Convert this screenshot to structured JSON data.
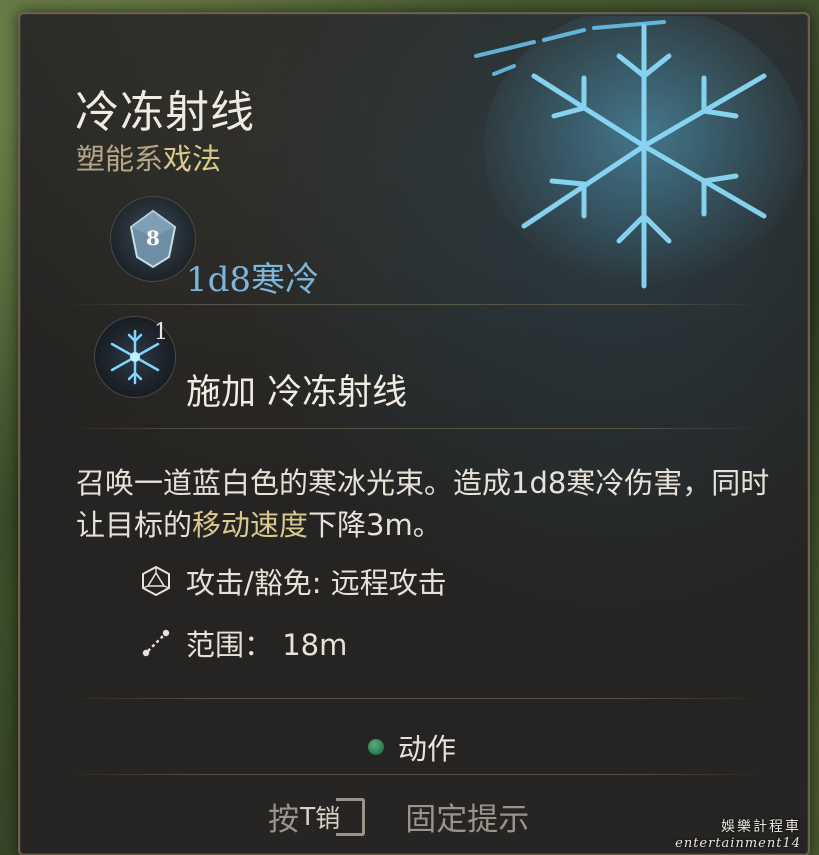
{
  "tooltip": {
    "title": "冷冻射线",
    "school": "塑能系",
    "spell_kind": "戏法",
    "damage": "1d8寒冷",
    "dice_face": "8",
    "spell_slot_count": "1",
    "cast_label": "施加 冷冻射线",
    "description_part1": "召唤一道蓝白色的寒冰光束。造成1d8寒冷伤害，同时让目标的",
    "description_highlight": "移动速度",
    "description_part2": "下降3m。",
    "properties": [
      {
        "icon": "d20-icon",
        "label": "攻击/豁免: 远程攻击"
      },
      {
        "icon": "range-icon",
        "label": "范围： 18m"
      }
    ],
    "action_type": "动作",
    "hint_prefix": "按",
    "hint_key": "T",
    "hint_suffix": "销",
    "hint_action": "固定提示"
  },
  "watermark": {
    "cn": "娛樂計程車",
    "en": "entertainment14"
  },
  "colors": {
    "title": "#f1ece2",
    "school": "#b6a684",
    "highlight": "#d9c98b",
    "damage": "#7db6d9",
    "action_dot": "#3f9a62"
  }
}
